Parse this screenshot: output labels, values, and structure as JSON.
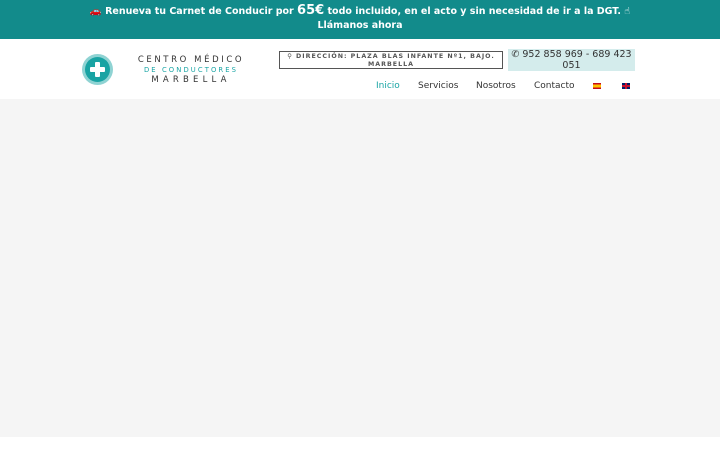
{
  "promo": {
    "icon": "car-icon",
    "text_before": "Renueva tu Carnet de Conducir por",
    "price": "65€",
    "text_after": "todo incluido, en el acto y sin necesidad de ir a la DGT.",
    "hand_icon": "pointing-hand-icon",
    "cta": "Llámanos ahora"
  },
  "logo": {
    "line1": "CENTRO MÉDICO",
    "line2": "DE CONDUCTORES",
    "line3": "MARBELLA",
    "brand_color": "#1aa5a5"
  },
  "address": {
    "icon": "map-marker-icon",
    "text": "DIRECCIÓN: PLAZA BLAS INFANTE Nº1, BAJO. MARBELLA"
  },
  "phone": {
    "icon": "phone-icon",
    "text": "952 858 969 - 689 423 051"
  },
  "nav": {
    "items": [
      {
        "label": "Inicio",
        "active": true
      },
      {
        "label": "Servicios",
        "active": false
      },
      {
        "label": "Nosotros",
        "active": false
      },
      {
        "label": "Contacto",
        "active": false
      }
    ],
    "languages": [
      "spain-flag-icon",
      "uk-flag-icon"
    ]
  },
  "colors": {
    "topbar": "#128b8b",
    "accent": "#1aa5a5",
    "content_bg": "#f5f5f5"
  }
}
